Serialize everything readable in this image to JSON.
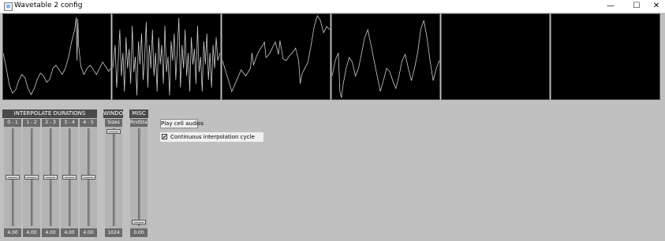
{
  "window": {
    "title": "Wavetable 2 config",
    "minimize_glyph": "—",
    "maximize_glyph": "☐",
    "close_glyph": "✕"
  },
  "groups": {
    "interpolate": {
      "label": "INTERPOLATE DURATIONS"
    },
    "window": {
      "label": "WINDOW"
    },
    "misc": {
      "label": "MISC"
    }
  },
  "sliders": [
    {
      "label": "0 - 1",
      "value": "4.00",
      "level": 0.5
    },
    {
      "label": "1 - 2",
      "value": "4.00",
      "level": 0.5
    },
    {
      "label": "2 - 3",
      "value": "4.00",
      "level": 0.5
    },
    {
      "label": "3 - 4",
      "value": "4.00",
      "level": 0.5
    },
    {
      "label": "4 - 5",
      "value": "4.00",
      "level": 0.5
    },
    {
      "label": "Sizes",
      "value": "1024",
      "level": 1.0
    },
    {
      "label": "RndStart",
      "value": "0.00",
      "level": 0.0
    }
  ],
  "controls": {
    "play_button": "Play cell audios",
    "continuous_checkbox": {
      "label": "Continuous interpolation cycle",
      "checked": true,
      "mark": "✔"
    }
  },
  "colors": {
    "background": "#c0c0c0",
    "waveform_bg": "#000000",
    "waveform_line": "#cfcfcf",
    "header": "#4a4a4a"
  }
}
